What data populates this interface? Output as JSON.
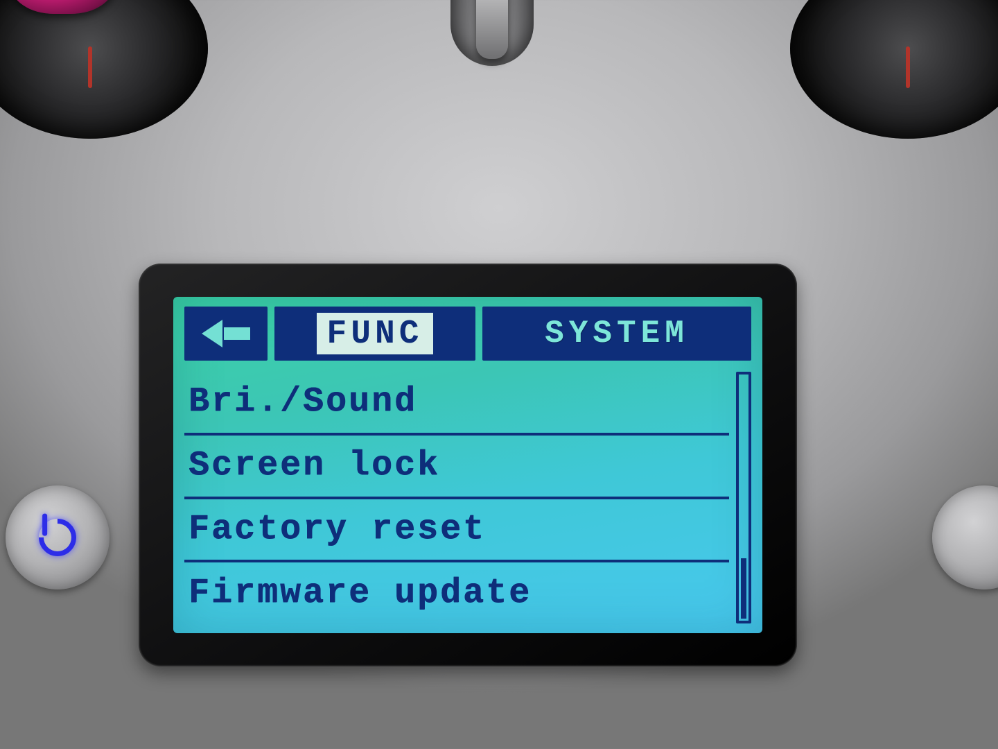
{
  "header": {
    "back_icon": "arrow-left",
    "tabs": {
      "func_label": "FUNC",
      "system_label": "SYSTEM",
      "active": "func"
    }
  },
  "menu": {
    "items": [
      {
        "label": "Bri./Sound"
      },
      {
        "label": "Screen lock"
      },
      {
        "label": "Factory reset"
      },
      {
        "label": "Firmware update"
      }
    ]
  },
  "scrollbar": {
    "position": "bottom"
  },
  "hardware_buttons": {
    "power_icon": "power",
    "select_icon": "round-button"
  }
}
